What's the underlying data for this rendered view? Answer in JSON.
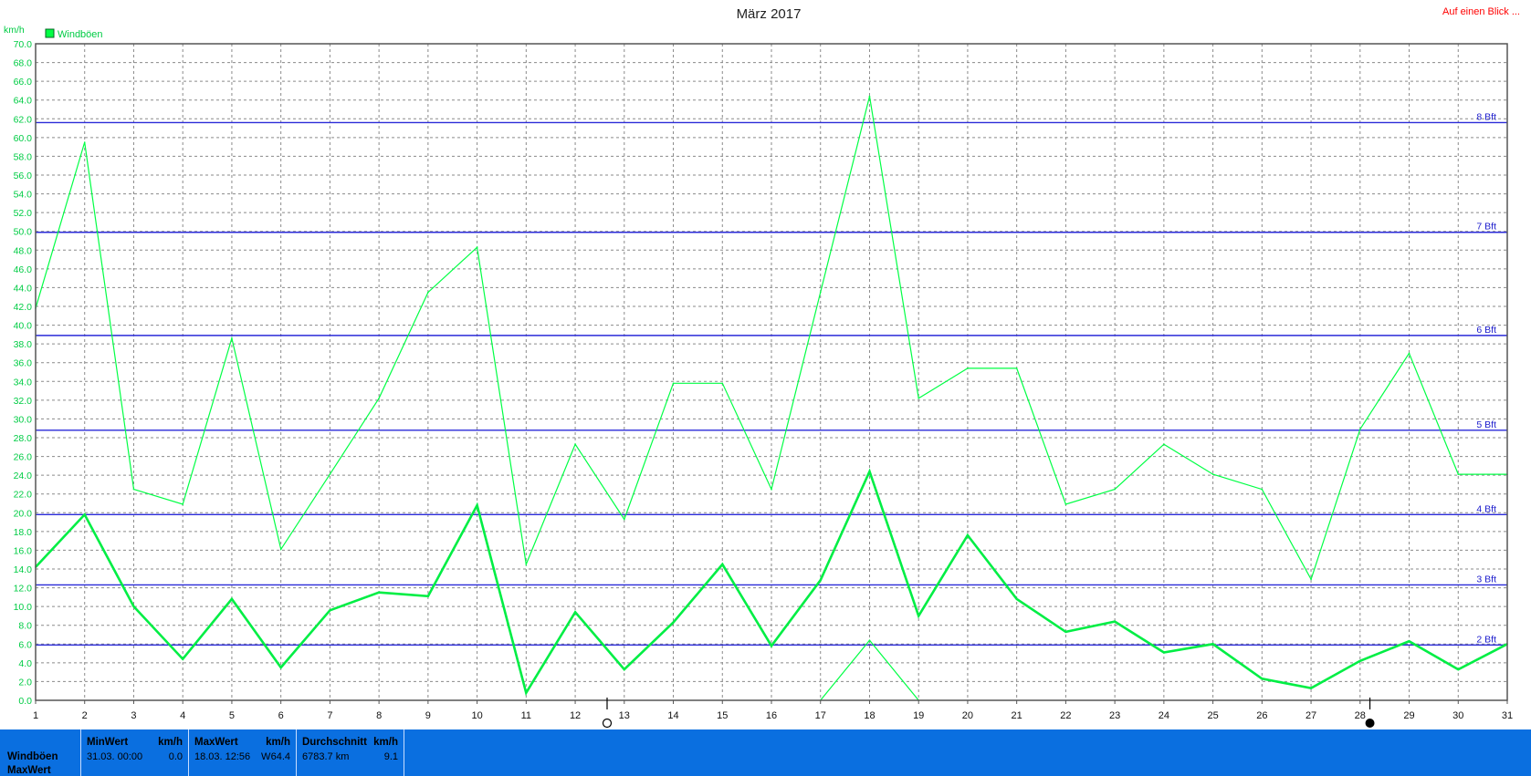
{
  "chart_data": {
    "type": "line",
    "title": "März 2017",
    "ylabel": "km/h",
    "link_text": "Auf einen Blick ...",
    "ylim": [
      0,
      70
    ],
    "ytick_step": 2,
    "grid": true,
    "legend": {
      "position": "top-left",
      "entries": [
        "Windböen"
      ]
    },
    "categories": [
      "1",
      "2",
      "3",
      "4",
      "5",
      "6",
      "7",
      "8",
      "9",
      "10",
      "11",
      "12",
      "13",
      "14",
      "15",
      "16",
      "17",
      "18",
      "19",
      "20",
      "21",
      "22",
      "23",
      "24",
      "25",
      "26",
      "27",
      "28",
      "29",
      "30",
      "31"
    ],
    "series": [
      {
        "name": "Windböen",
        "role": "max",
        "color": "#00ff44",
        "values": [
          41.8,
          59.5,
          22.5,
          20.9,
          38.6,
          16.1,
          24.1,
          32.2,
          43.5,
          48.3,
          14.5,
          27.3,
          19.3,
          33.8,
          33.8,
          22.5,
          43.5,
          64.4,
          32.2,
          35.4,
          35.4,
          20.9,
          22.5,
          27.3,
          24.1,
          22.5,
          12.9,
          28.9,
          37.0,
          24.1,
          24.1
        ]
      },
      {
        "role": "avg",
        "color": "#00ee44",
        "values": [
          14.2,
          19.8,
          10.0,
          4.4,
          10.8,
          3.5,
          9.6,
          11.5,
          11.1,
          20.8,
          0.8,
          9.4,
          3.3,
          8.3,
          14.5,
          5.8,
          12.8,
          24.4,
          9.0,
          17.6,
          10.8,
          7.3,
          8.4,
          5.1,
          6.0,
          2.3,
          1.3,
          4.2,
          6.3,
          3.3,
          6.0
        ]
      },
      {
        "role": "min",
        "color": "#00ff44",
        "points": [
          [
            17,
            0.0
          ],
          [
            18,
            6.4
          ],
          [
            19,
            0.0
          ]
        ]
      }
    ],
    "beaufort": [
      {
        "label": "2 Bft",
        "value": 5.9
      },
      {
        "label": "3 Bft",
        "value": 12.3
      },
      {
        "label": "4 Bft",
        "value": 19.8
      },
      {
        "label": "5 Bft",
        "value": 28.8
      },
      {
        "label": "6 Bft",
        "value": 38.9
      },
      {
        "label": "7 Bft",
        "value": 49.9
      },
      {
        "label": "8 Bft",
        "value": 61.6
      }
    ],
    "moon_phases": [
      {
        "day": 12.65,
        "phase": "full-moon-icon"
      },
      {
        "day": 28.2,
        "phase": "new-moon-icon"
      }
    ]
  },
  "stats": {
    "row_labels": [
      "Windböen",
      "MaxWert"
    ],
    "min": {
      "header": "MinWert",
      "unit": "km/h",
      "date": "31.03.  00:00",
      "value": "0.0"
    },
    "max": {
      "header": "MaxWert",
      "unit": "km/h",
      "date": "18.03.  12:56",
      "dir": "W",
      "value": "64.4"
    },
    "avg": {
      "header": "Durchschnitt",
      "unit": "km/h",
      "dist": "6783.7 km",
      "value": "9.1"
    }
  }
}
